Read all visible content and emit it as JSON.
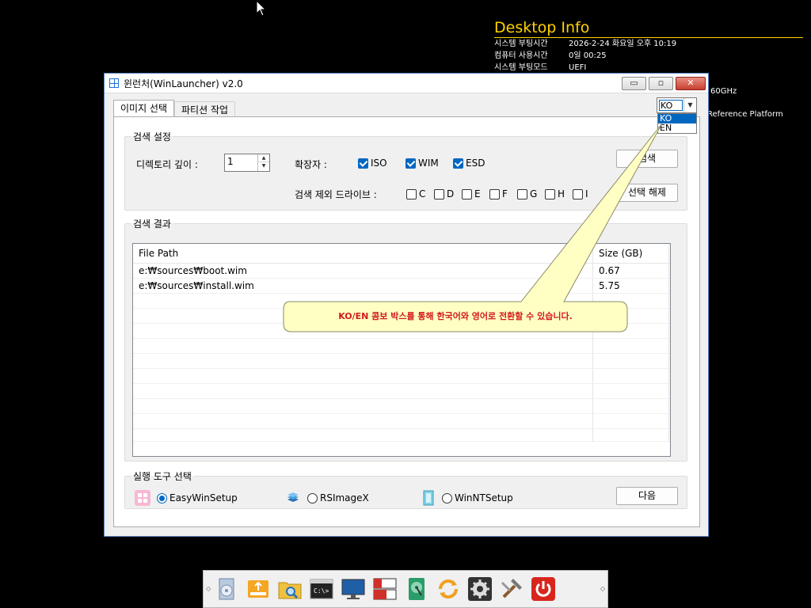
{
  "desktop_info": {
    "title": "Desktop Info",
    "rows": [
      {
        "key": "시스템 부팅시간",
        "value": "2026-2-24 화요일 오후 10:19"
      },
      {
        "key": "컴퓨터 사용시간",
        "value": "0일 00:25"
      },
      {
        "key": "시스템 부팅모드",
        "value": "UEFI"
      }
    ],
    "cpu_fragment": "60GHz",
    "board_fragment": "Reference Platform"
  },
  "window": {
    "title": "윈런처(WinLauncher) v2.0",
    "minimize_label": "▭",
    "maximize_label": "▫",
    "close_label": "✕"
  },
  "tabs": [
    {
      "label": "이미지 선택"
    },
    {
      "label": "파티션 작업"
    }
  ],
  "language_combo": {
    "selected": "KO",
    "options": [
      "KO",
      "EN"
    ]
  },
  "search_settings": {
    "legend": "검색 설정",
    "depth_label": "디렉토리 깊이 :",
    "depth_value": "1",
    "ext_label": "확장자 :",
    "extensions": [
      {
        "label": "ISO",
        "checked": true
      },
      {
        "label": "WIM",
        "checked": true
      },
      {
        "label": "ESD",
        "checked": true
      }
    ],
    "exclude_label": "검색 제외 드라이브 :",
    "drives": [
      {
        "label": "C",
        "checked": false
      },
      {
        "label": "D",
        "checked": false
      },
      {
        "label": "E",
        "checked": false
      },
      {
        "label": "F",
        "checked": false
      },
      {
        "label": "G",
        "checked": false
      },
      {
        "label": "H",
        "checked": false
      },
      {
        "label": "I",
        "checked": false
      }
    ],
    "search_button": "검색",
    "deselect_button": "선택 해제"
  },
  "results": {
    "legend": "검색 결과",
    "columns": [
      "File Path",
      "Size (GB)"
    ],
    "rows": [
      {
        "path": "e:₩sources₩boot.wim",
        "size": "0.67"
      },
      {
        "path": "e:₩sources₩install.wim",
        "size": "5.75"
      }
    ]
  },
  "tools": {
    "legend": "실행 도구 선택",
    "options": [
      {
        "label": "EasyWinSetup",
        "selected": true
      },
      {
        "label": "RSImageX",
        "selected": false
      },
      {
        "label": "WinNTSetup",
        "selected": false
      }
    ],
    "next_button": "다음"
  },
  "callout": {
    "text": "KO/EN 콤보 박스를 통해 한국어와 영어로 전환할 수 있습니다.",
    "color": "#d21a1a"
  },
  "taskbar": {
    "icons": [
      "setup-disc-icon",
      "usb-drive-icon",
      "folder-search-icon",
      "command-prompt-icon",
      "monitor-icon",
      "disk-partition-icon",
      "hard-disk-icon",
      "sync-icon",
      "settings-gear-icon",
      "tools-hammer-icon",
      "power-icon"
    ]
  }
}
